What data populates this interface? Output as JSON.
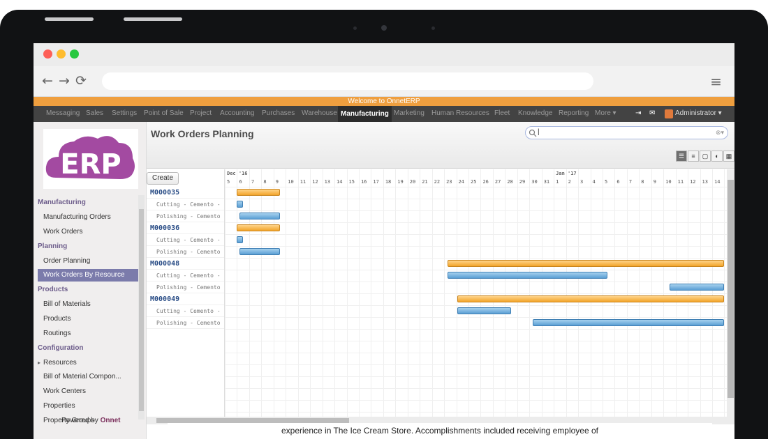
{
  "browser": {
    "nav_back": "←",
    "nav_forward": "→",
    "nav_reload": "⟳",
    "menu": "≡"
  },
  "app": {
    "welcome": "Welcome to OnnetERP",
    "menu_items": [
      "Messaging",
      "Sales",
      "Settings",
      "Point of Sale",
      "Project",
      "Accounting",
      "Purchases",
      "Warehouse",
      "Manufacturing",
      "Marketing",
      "Human Resources",
      "Fleet",
      "Knowledge",
      "Reporting",
      "More ▾"
    ],
    "active_menu": "Manufacturing",
    "user": "Administrator ▾",
    "logo_text": "ERP",
    "accent": "#ef9f3f",
    "brand_color": "#a34aa1"
  },
  "sidebar": {
    "sections": [
      {
        "title": "Manufacturing",
        "items": [
          "Manufacturing Orders",
          "Work Orders"
        ]
      },
      {
        "title": "Planning",
        "items": [
          "Order Planning",
          "Work Orders By Resource"
        ]
      },
      {
        "title": "Products",
        "items": [
          "Bill of Materials",
          "Products",
          "Routings"
        ]
      },
      {
        "title": "Configuration",
        "items": [
          "Resources",
          "Bill of Material Compon...",
          "Work Centers",
          "Properties",
          "Property Groups"
        ]
      }
    ],
    "active_item": "Work Orders By Resource",
    "powered_prefix": "Powered by",
    "powered_brand": "Onnet"
  },
  "content": {
    "title": "Work Orders Planning",
    "search_value": "",
    "create_label": "Create",
    "view_buttons": [
      "gantt",
      "list",
      "form",
      "graph",
      "calendar"
    ],
    "active_view": "gantt"
  },
  "gantt": {
    "months": [
      {
        "label": "Dec '16"
      },
      {
        "label": "Jan '17"
      }
    ],
    "days": [
      "5",
      "6",
      "7",
      "8",
      "9",
      "10",
      "11",
      "12",
      "13",
      "14",
      "15",
      "16",
      "17",
      "18",
      "19",
      "20",
      "21",
      "22",
      "23",
      "24",
      "25",
      "26",
      "27",
      "28",
      "29",
      "30",
      "31",
      "1",
      "2",
      "3",
      "4",
      "5",
      "6",
      "7",
      "8",
      "9",
      "10",
      "11",
      "12",
      "13",
      "14"
    ],
    "rows": [
      {
        "label": "M000035",
        "type": "group",
        "start": 1,
        "end": 4.5
      },
      {
        "label": "Cutting - Cemento - iTr...",
        "type": "task",
        "start": 1,
        "end": 1.5
      },
      {
        "label": "Polishing - Cemento - iT...",
        "type": "task",
        "start": 1.2,
        "end": 4.5
      },
      {
        "label": "M000036",
        "type": "group",
        "start": 1,
        "end": 4.5
      },
      {
        "label": "Cutting - Cemento - iTr...",
        "type": "task",
        "start": 1,
        "end": 1.5
      },
      {
        "label": "Polishing - Cemento - iT...",
        "type": "task",
        "start": 1.2,
        "end": 4.5
      },
      {
        "label": "M000048",
        "type": "group",
        "start": 18.3,
        "end": 41
      },
      {
        "label": "Cutting - Cemento - iTr...",
        "type": "task",
        "start": 18.3,
        "end": 31.4
      },
      {
        "label": "Polishing - Cemento - iT...",
        "type": "task",
        "start": 36.5,
        "end": 41
      },
      {
        "label": "M000049",
        "type": "group",
        "start": 19.1,
        "end": 41
      },
      {
        "label": "Cutting - Cemento - iTr...",
        "type": "task",
        "start": 19.1,
        "end": 23.5
      },
      {
        "label": "Polishing - Cemento - iT...",
        "type": "task",
        "start": 25.3,
        "end": 41
      }
    ]
  },
  "resume_text": "experience in The Ice Cream Store. Accomplishments included receiving employee of"
}
